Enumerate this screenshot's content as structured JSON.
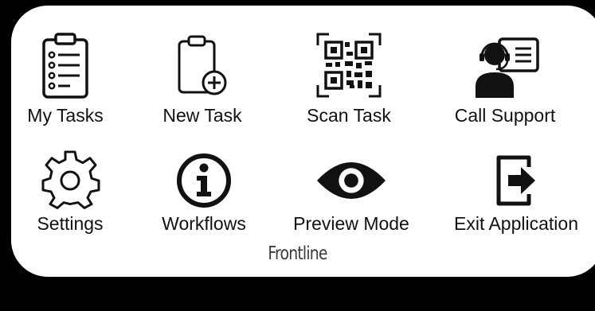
{
  "tiles": [
    {
      "label": "My Tasks",
      "icon": "clipboard-list-icon"
    },
    {
      "label": "New Task",
      "icon": "clipboard-add-icon"
    },
    {
      "label": "Scan Task",
      "icon": "qr-scan-icon"
    },
    {
      "label": "Call Support",
      "icon": "support-agent-icon"
    },
    {
      "label": "Settings",
      "icon": "gear-icon"
    },
    {
      "label": "Workflows",
      "icon": "info-icon"
    },
    {
      "label": "Preview Mode",
      "icon": "eye-icon"
    },
    {
      "label": "Exit Application",
      "icon": "exit-icon"
    }
  ],
  "brand": "Frontline",
  "colors": {
    "background": "#000000",
    "panel": "#ffffff",
    "icon": "#111111"
  }
}
